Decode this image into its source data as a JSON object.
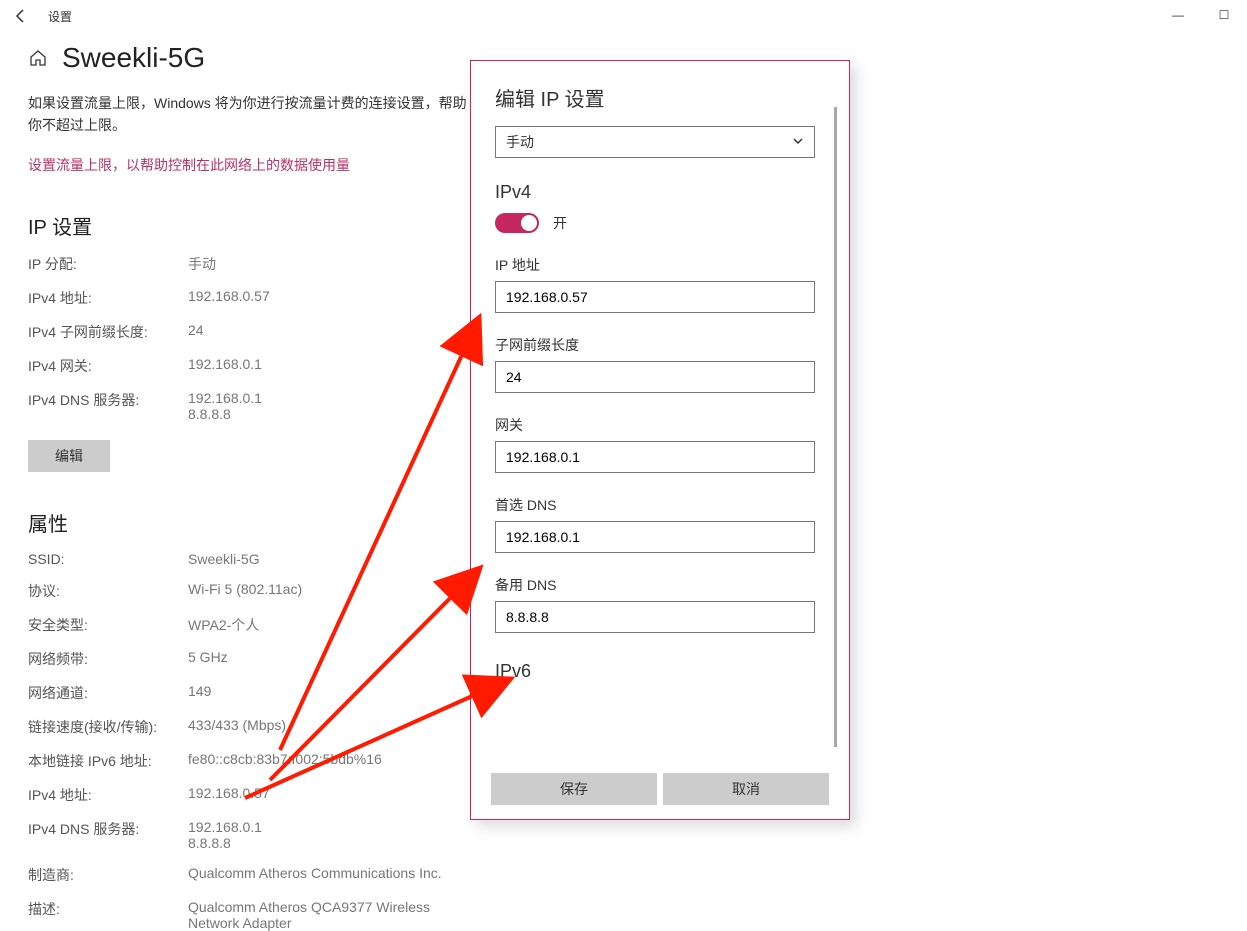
{
  "window": {
    "title": "设置",
    "minimize": "—",
    "maximize": "☐"
  },
  "page": {
    "title": "Sweekli-5G",
    "help_text": "如果设置流量上限，Windows 将为你进行按流量计费的连接设置，帮助你不超过上限。",
    "link": "设置流量上限，以帮助控制在此网络上的数据使用量"
  },
  "ip_settings": {
    "heading": "IP 设置",
    "rows": {
      "assign_label": "IP 分配:",
      "assign_value": "手动",
      "ipv4_addr_label": "IPv4 地址:",
      "ipv4_addr_value": "192.168.0.57",
      "prefix_label": "IPv4 子网前缀长度:",
      "prefix_value": "24",
      "gateway_label": "IPv4 网关:",
      "gateway_value": "192.168.0.1",
      "dns_label": "IPv4 DNS 服务器:",
      "dns_value1": "192.168.0.1",
      "dns_value2": "8.8.8.8"
    },
    "edit_btn": "编辑"
  },
  "properties": {
    "heading": "属性",
    "rows": {
      "ssid_label": "SSID:",
      "ssid_value": "Sweekli-5G",
      "proto_label": "协议:",
      "proto_value": "Wi-Fi 5 (802.11ac)",
      "sec_label": "安全类型:",
      "sec_value": "WPA2-个人",
      "band_label": "网络频带:",
      "band_value": "5 GHz",
      "chan_label": "网络通道:",
      "chan_value": "149",
      "speed_label": "链接速度(接收/传输):",
      "speed_value": "433/433 (Mbps)",
      "ipv6_label": "本地链接 IPv6 地址:",
      "ipv6_value": "fe80::c8cb:83b7:f002:5bdb%16",
      "ipv4a_label": "IPv4 地址:",
      "ipv4a_value": "192.168.0.57",
      "ipv4d_label": "IPv4 DNS 服务器:",
      "ipv4d_value1": "192.168.0.1",
      "ipv4d_value2": "8.8.8.8",
      "mfr_label": "制造商:",
      "mfr_value": "Qualcomm Atheros Communications Inc.",
      "desc_label": "描述:",
      "desc_value": "Qualcomm Atheros QCA9377 Wireless Network Adapter"
    }
  },
  "modal": {
    "title": "编辑 IP 设置",
    "mode_value": "手动",
    "ipv4_heading": "IPv4",
    "toggle_text": "开",
    "ip_label": "IP 地址",
    "ip_value": "192.168.0.57",
    "prefix_label": "子网前缀长度",
    "prefix_value": "24",
    "gateway_label": "网关",
    "gateway_value": "192.168.0.1",
    "dns1_label": "首选 DNS",
    "dns1_value": "192.168.0.1",
    "dns2_label": "备用 DNS",
    "dns2_value": "8.8.8.8",
    "ipv6_heading": "IPv6",
    "save": "保存",
    "cancel": "取消"
  }
}
